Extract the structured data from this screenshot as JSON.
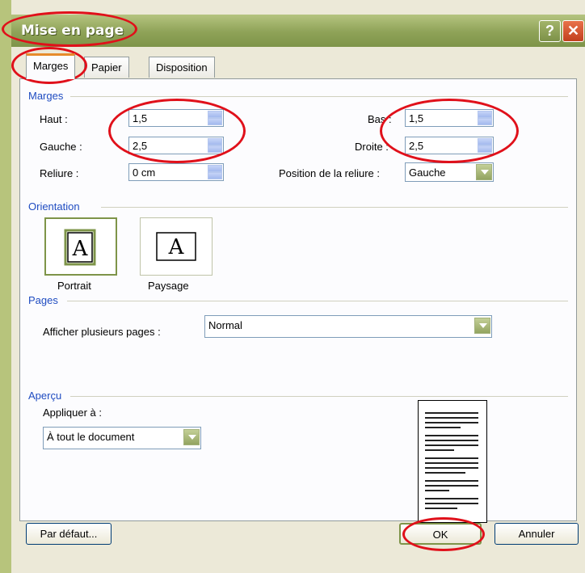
{
  "window": {
    "title": "Mise en page",
    "help_glyph": "?",
    "close_glyph": "✕"
  },
  "tabs": [
    {
      "label": "Marges",
      "active": true
    },
    {
      "label": "Papier",
      "active": false
    },
    {
      "label": "Disposition",
      "active": false
    }
  ],
  "marges": {
    "group_title": "Marges",
    "haut": {
      "label": "Haut :",
      "value": "1,5"
    },
    "gauche": {
      "label": "Gauche :",
      "value": "2,5"
    },
    "reliure": {
      "label": "Reliure :",
      "value": "0 cm"
    },
    "bas": {
      "label": "Bas :",
      "value": "1,5"
    },
    "droite": {
      "label": "Droite :",
      "value": "2,5"
    },
    "position_reliure": {
      "label": "Position de la reliure :",
      "value": "Gauche"
    }
  },
  "orientation": {
    "group_title": "Orientation",
    "portrait_label": "Portrait",
    "paysage_label": "Paysage",
    "selected": "portrait",
    "glyph": "A"
  },
  "pages": {
    "group_title": "Pages",
    "afficher_label": "Afficher plusieurs pages :",
    "afficher_value": "Normal"
  },
  "apercu": {
    "group_title": "Aperçu",
    "appliquer_label": "Appliquer à :",
    "appliquer_value": "À tout le document"
  },
  "buttons": {
    "par_defaut": "Par défaut...",
    "ok": "OK",
    "annuler": "Annuler"
  },
  "colors": {
    "title_bar": "#8ea257",
    "accent": "#7e9449",
    "annotation": "#e0101a",
    "group_title": "#1f4cc1"
  },
  "icons": {
    "spin_up": "chevron-up-icon",
    "spin_down": "chevron-down-icon",
    "dropdown": "chevron-down-icon",
    "page": "page-a-icon"
  }
}
